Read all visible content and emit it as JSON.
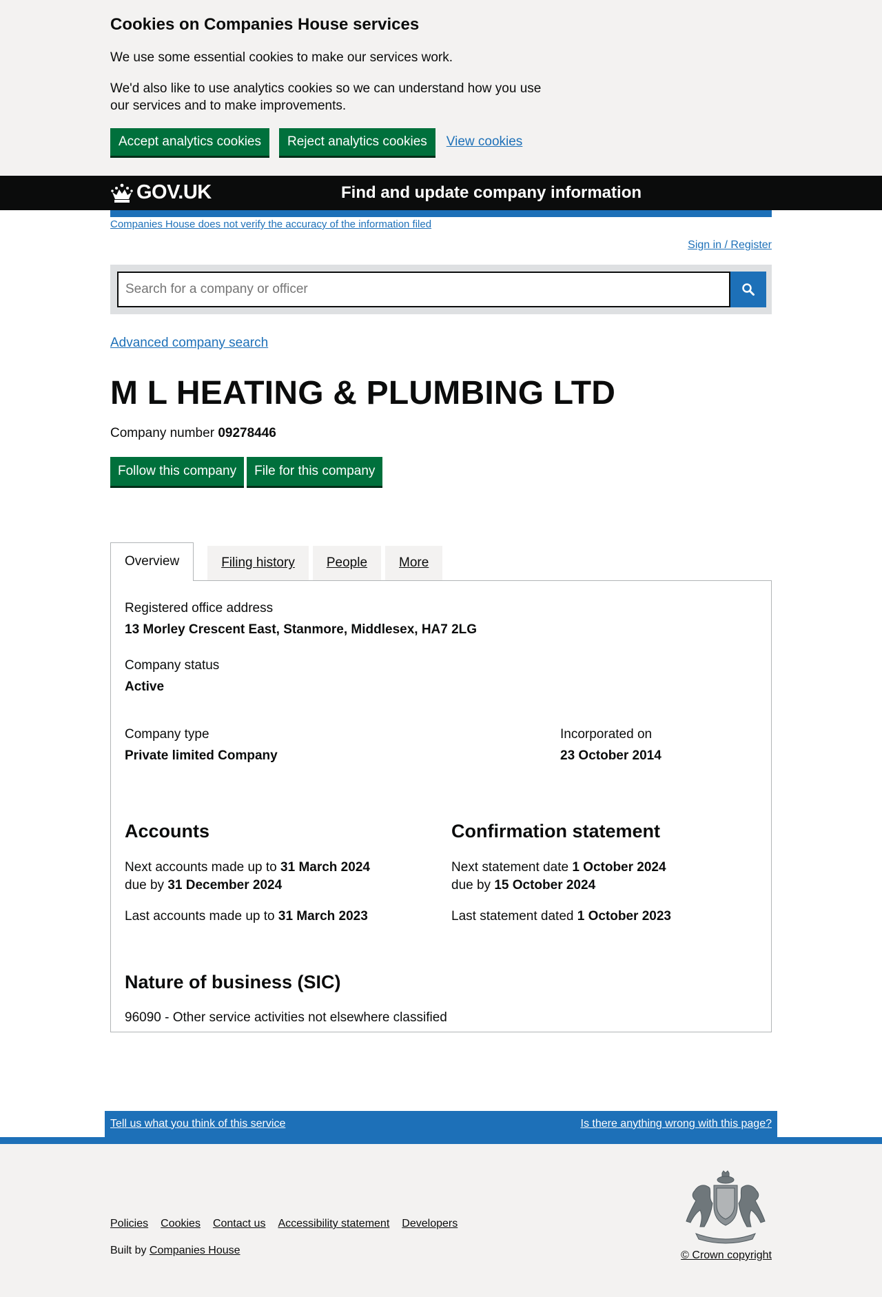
{
  "cookie_banner": {
    "title": "Cookies on Companies House services",
    "p1": "We use some essential cookies to make our services work.",
    "p2": "We'd also like to use analytics cookies so we can understand how you use our services and to make improvements.",
    "accept": "Accept analytics cookies",
    "reject": "Reject analytics cookies",
    "view": "View cookies"
  },
  "header": {
    "logo": "GOV.UK",
    "service": "Find and update company information"
  },
  "disclaimer": "Companies House does not verify the accuracy of the information filed",
  "signin": "Sign in / Register",
  "search": {
    "placeholder": "Search for a company or officer"
  },
  "advanced_search": "Advanced company search",
  "company": {
    "name": "M L HEATING & PLUMBING LTD",
    "number_label": "Company number",
    "number": "09278446",
    "follow": "Follow this company",
    "file": "File for this company"
  },
  "tabs": {
    "overview": "Overview",
    "filing": "Filing history",
    "people": "People",
    "more": "More"
  },
  "overview": {
    "address_label": "Registered office address",
    "address": "13 Morley Crescent East, Stanmore, Middlesex, HA7 2LG",
    "status_label": "Company status",
    "status": "Active",
    "type_label": "Company type",
    "type": "Private limited Company",
    "incorporated_label": "Incorporated on",
    "incorporated": "23 October 2014",
    "accounts": {
      "title": "Accounts",
      "next_label": "Next accounts made up to",
      "next_date": "31 March 2024",
      "due_label": "due by",
      "due_date": "31 December 2024",
      "last_label": "Last accounts made up to",
      "last_date": "31 March 2023"
    },
    "confirmation": {
      "title": "Confirmation statement",
      "next_label": "Next statement date",
      "next_date": "1 October 2024",
      "due_label": "due by",
      "due_date": "15 October 2024",
      "last_label": "Last statement dated",
      "last_date": "1 October 2023"
    },
    "sic": {
      "title": "Nature of business (SIC)",
      "item": "96090 - Other service activities not elsewhere classified"
    }
  },
  "feedback": {
    "left": "Tell us what you think of this service",
    "right": "Is there anything wrong with this page?"
  },
  "footer": {
    "links": [
      "Policies",
      "Cookies",
      "Contact us",
      "Accessibility statement",
      "Developers"
    ],
    "built_by": "Built by",
    "built_by_link": "Companies House",
    "copyright": "© Crown copyright"
  }
}
